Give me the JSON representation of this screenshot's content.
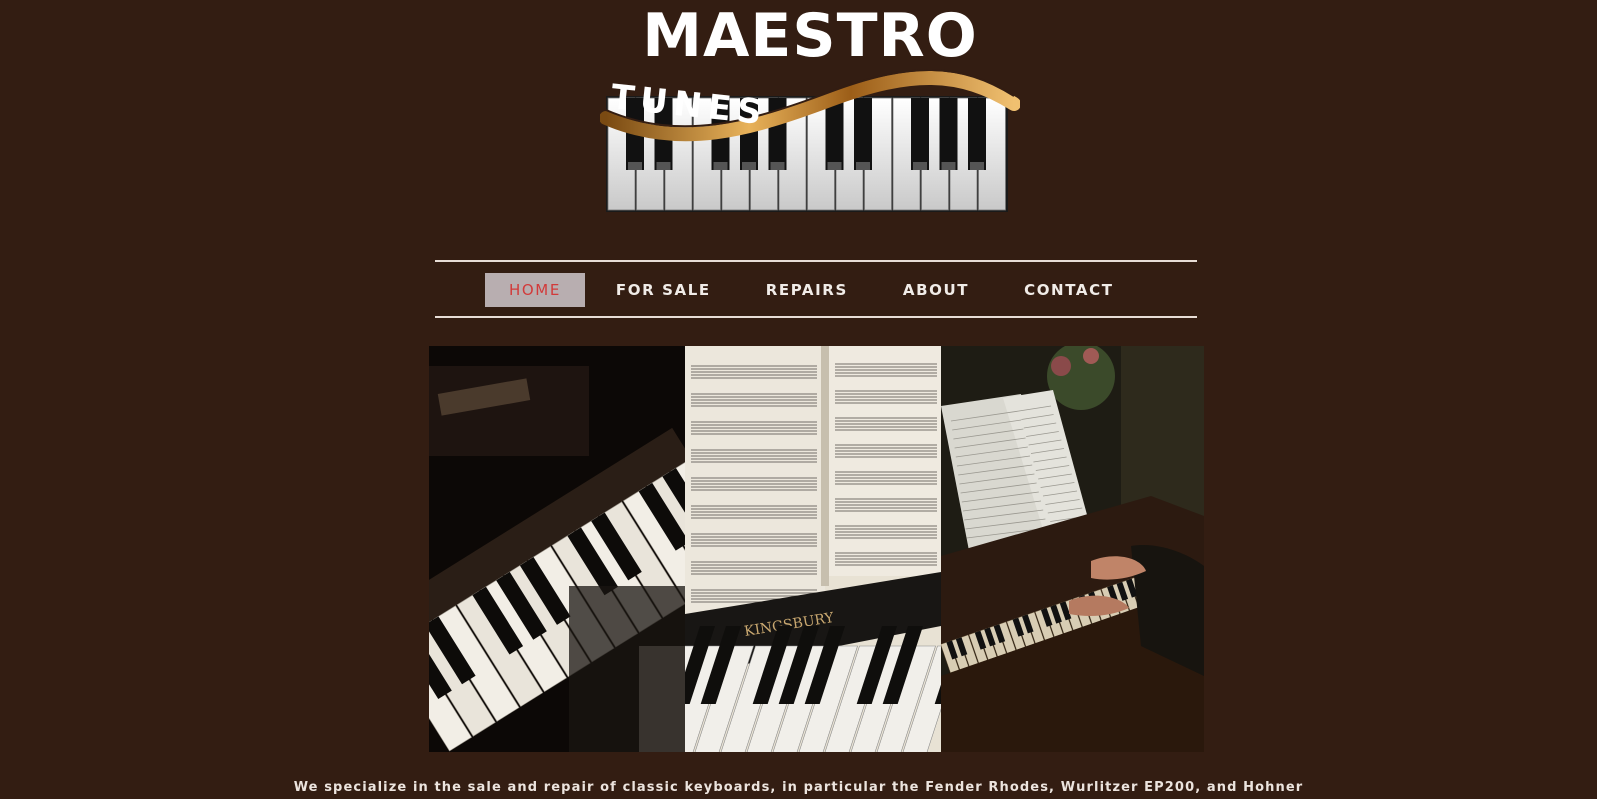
{
  "brand": {
    "line1": "MAESTRO",
    "line2": "TUNES"
  },
  "nav": {
    "items": [
      {
        "label": "HOME",
        "active": true
      },
      {
        "label": "FOR SALE",
        "active": false
      },
      {
        "label": "REPAIRS",
        "active": false
      },
      {
        "label": "ABOUT",
        "active": false
      },
      {
        "label": "CONTACT",
        "active": false
      }
    ]
  },
  "hero": {
    "photos": [
      "piano-keys-photo",
      "sheet-music-photo",
      "pianist-photo"
    ]
  },
  "intro": {
    "text": "We specialize in the sale and repair of classic keyboards, in particular the Fender Rhodes, Wurlitzer EP200, and Hohner"
  },
  "colors": {
    "background": "#331d12",
    "nav_active_bg": "#b8aeb0",
    "nav_active_text": "#d23a3a",
    "gold": "#c8862a"
  }
}
